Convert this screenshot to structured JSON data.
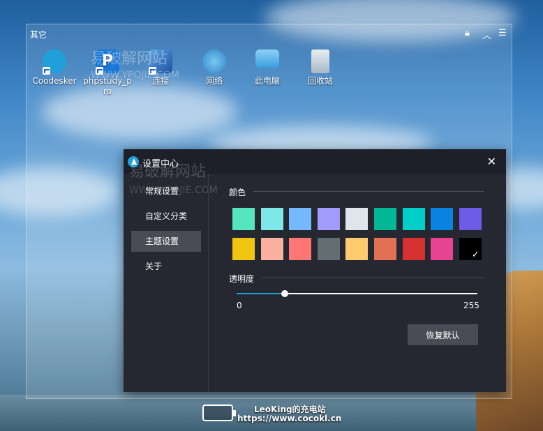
{
  "fence": {
    "title": "其它",
    "icons": [
      {
        "label": "Coodesker",
        "icon": "coodesker-app-icon",
        "color": "#1fa0d8"
      },
      {
        "label": "phpstudy_pro",
        "icon": "phpstudy-app-icon",
        "color": "#1a78d6"
      },
      {
        "label": "连接",
        "icon": "remote-connect-icon",
        "color": "#2a6bc4"
      },
      {
        "label": "网络",
        "icon": "network-globe-icon",
        "color": "#2e86c9"
      },
      {
        "label": "此电脑",
        "icon": "computer-icon",
        "color": "#3aa0e0"
      },
      {
        "label": "回收站",
        "icon": "recycle-bin-icon",
        "color": "#c9d6de"
      }
    ],
    "controls": [
      "lock-icon",
      "collapse-icon",
      "menu-icon"
    ]
  },
  "dialog": {
    "title": "设置中心",
    "sidebar": [
      {
        "label": "常规设置",
        "active": false
      },
      {
        "label": "自定义分类",
        "active": false
      },
      {
        "label": "主题设置",
        "active": true
      },
      {
        "label": "关于",
        "active": false
      }
    ],
    "color_section": "颜色",
    "colors_row1": [
      "#55e6c1",
      "#7ee7e7",
      "#74b9ff",
      "#a29bfe",
      "#dfe6e9",
      "#00b894",
      "#00cec9",
      "#0984e3",
      "#6c5ce7"
    ],
    "colors_row2": [
      "#f1c40f",
      "#fab1a0",
      "#ff7675",
      "#636e72",
      "#fdcb6e",
      "#e17055",
      "#d63031",
      "#e84393",
      "#000000"
    ],
    "selected_color": "#000000",
    "opacity_section": "透明度",
    "opacity_min": "0",
    "opacity_max": "255",
    "opacity_value_fraction": 0.2,
    "reset_label": "恢复默认"
  },
  "watermark": {
    "title": "易破解网站",
    "sub": "WWW.YPOJIE.COM"
  },
  "footer": {
    "line1": "LeoKing的充电站",
    "line2": "https://www.cocokl.cn"
  }
}
